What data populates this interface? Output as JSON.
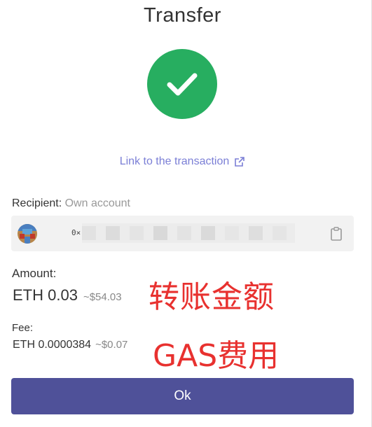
{
  "header": {
    "title": "Transfer"
  },
  "status": {
    "icon": "checkmark-icon",
    "color": "#27ae60"
  },
  "transaction_link": {
    "label": "Link to the transaction",
    "icon": "external-link-icon"
  },
  "recipient": {
    "label": "Recipient:",
    "value": "Own account",
    "address_prefix": "0×",
    "copy_icon": "clipboard-icon"
  },
  "amount": {
    "label": "Amount:",
    "value": "ETH 0.03",
    "fiat": "~$54.03",
    "annotation": "转账金额"
  },
  "fee": {
    "label": "Fee:",
    "value": "ETH 0.0000384",
    "fiat": "~$0.07",
    "annotation": "GAS费用"
  },
  "actions": {
    "ok_label": "Ok",
    "button_color": "#4f5199"
  },
  "colors": {
    "accent": "#7b7fd6",
    "annotation": "#e8312f"
  }
}
